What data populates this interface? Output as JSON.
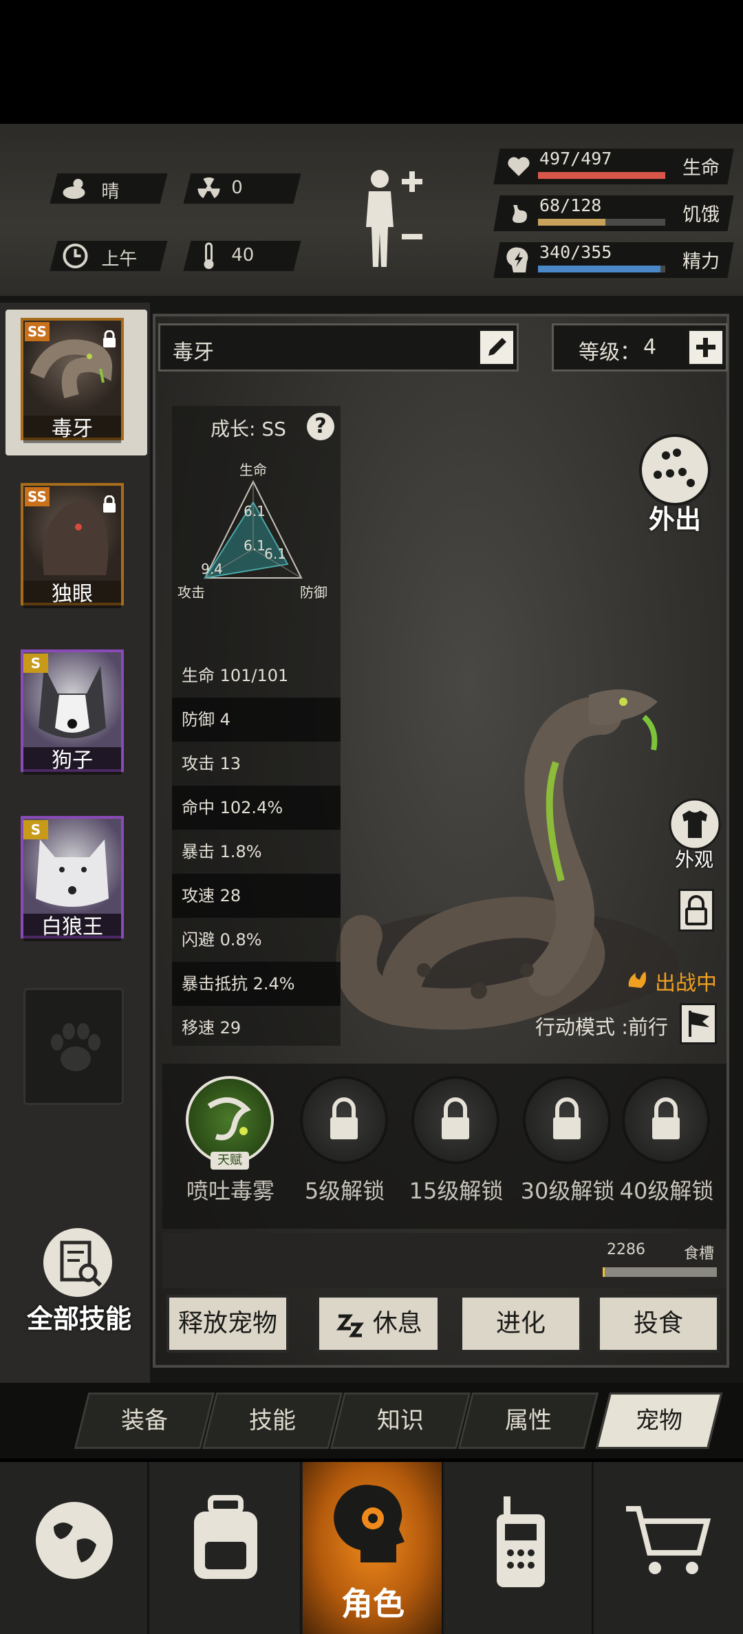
{
  "status": {
    "weather": "晴",
    "radiation": "0",
    "time_of_day": "上午",
    "temperature": "40",
    "health": {
      "text": "497/497",
      "label": "生命",
      "fraction": 1.0,
      "color": "#d8564a"
    },
    "hunger": {
      "text": "68/128",
      "label": "饥饿",
      "fraction": 0.53,
      "color": "#c8a25a"
    },
    "energy": {
      "text": "340/355",
      "label": "精力",
      "fraction": 0.96,
      "color": "#4a88c8"
    }
  },
  "pets": [
    {
      "name": "毒牙",
      "rank": "SS",
      "locked": true,
      "selected": true
    },
    {
      "name": "独眼",
      "rank": "SS",
      "locked": true,
      "selected": false
    },
    {
      "name": "狗子",
      "rank": "S",
      "locked": false,
      "selected": false
    },
    {
      "name": "白狼王",
      "rank": "S",
      "locked": false,
      "selected": false
    }
  ],
  "sidebar": {
    "all_skills_label": "全部技能"
  },
  "pet_detail": {
    "name": "毒牙",
    "level_label": "等级：",
    "level": "4",
    "growth_label": "成长: SS",
    "radar": {
      "top_label": "生命",
      "left_label": "攻击",
      "right_label": "防御",
      "top_value": "6.1",
      "left_value": "9.4",
      "right_value": "6.1",
      "center_value": "6.1"
    },
    "stats": [
      "生命 101/101",
      "防御 4",
      "攻击 13",
      "命中 102.4%",
      "暴击 1.8%",
      "攻速 28",
      "闪避 0.8%",
      "暴击抵抗 2.4%",
      "移速 29"
    ],
    "go_out_label": "外出",
    "appearance_label": "外观",
    "battle_status": "出战中",
    "action_mode": "行动模式 :前行"
  },
  "skills": [
    {
      "label": "喷吐毒雾",
      "badge": "天赋",
      "locked": false
    },
    {
      "label": "5级解锁",
      "locked": true
    },
    {
      "label": "15级解锁",
      "locked": true
    },
    {
      "label": "30级解锁",
      "locked": true
    },
    {
      "label": "40级解锁",
      "locked": true
    }
  ],
  "food": {
    "amount": "2286",
    "label": "食槽",
    "fraction": 0.02
  },
  "actions": {
    "release": "释放宠物",
    "rest": "休息",
    "evolve": "进化",
    "feed": "投食"
  },
  "tabs": [
    "装备",
    "技能",
    "知识",
    "属性",
    "宠物"
  ],
  "active_tab": "宠物",
  "bottom_nav": {
    "character_label": "角色"
  }
}
